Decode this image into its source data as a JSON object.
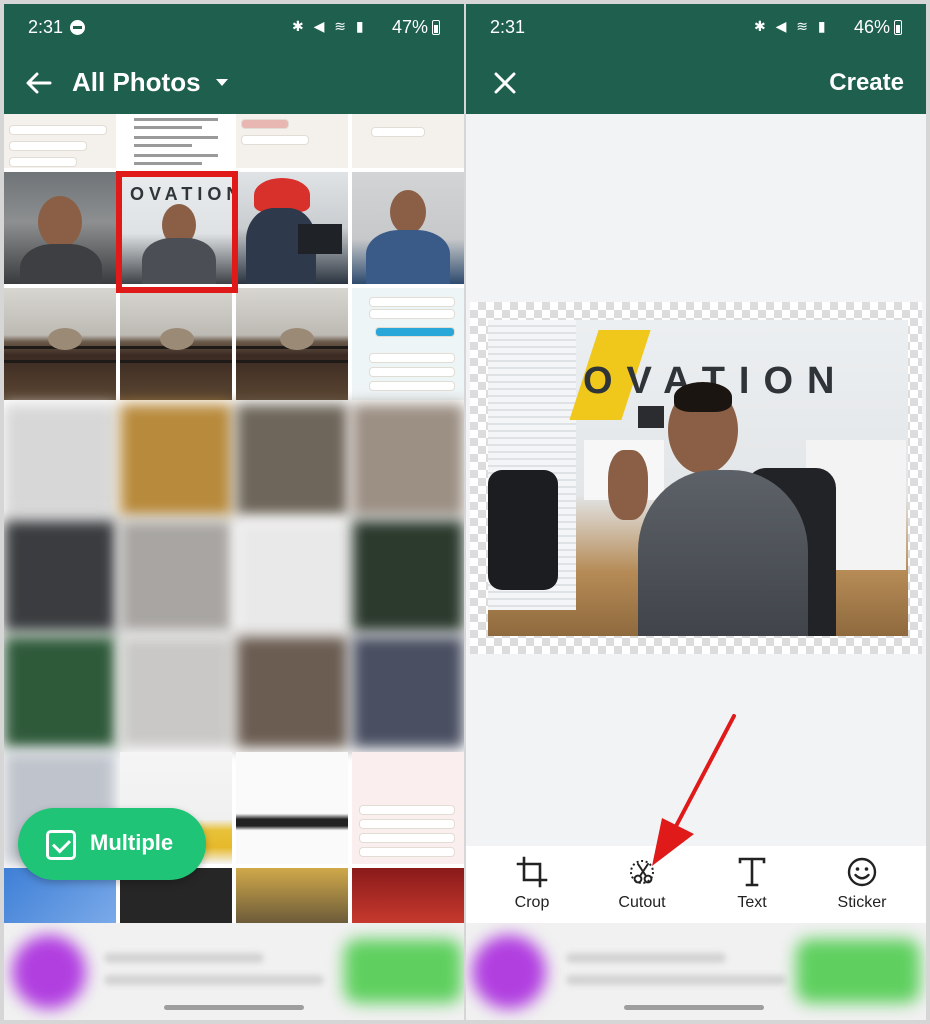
{
  "left_screen": {
    "status_bar": {
      "time": "2:31",
      "battery": "47%"
    },
    "app_bar": {
      "title": "All Photos"
    },
    "multiple_button": {
      "label": "Multiple"
    }
  },
  "right_screen": {
    "status_bar": {
      "time": "2:31",
      "battery": "46%"
    },
    "app_bar": {
      "create_label": "Create"
    },
    "photo_banner": "OVATION",
    "tools": [
      {
        "label": "Crop",
        "icon": "crop-icon"
      },
      {
        "label": "Cutout",
        "icon": "scissors-icon"
      },
      {
        "label": "Text",
        "icon": "text-icon"
      },
      {
        "label": "Sticker",
        "icon": "smiley-icon"
      }
    ]
  },
  "colors": {
    "header_green": "#1e5f4d",
    "multiple_green": "#1fc476",
    "highlight_red": "#e01919",
    "annotation_red": "#e01919"
  }
}
